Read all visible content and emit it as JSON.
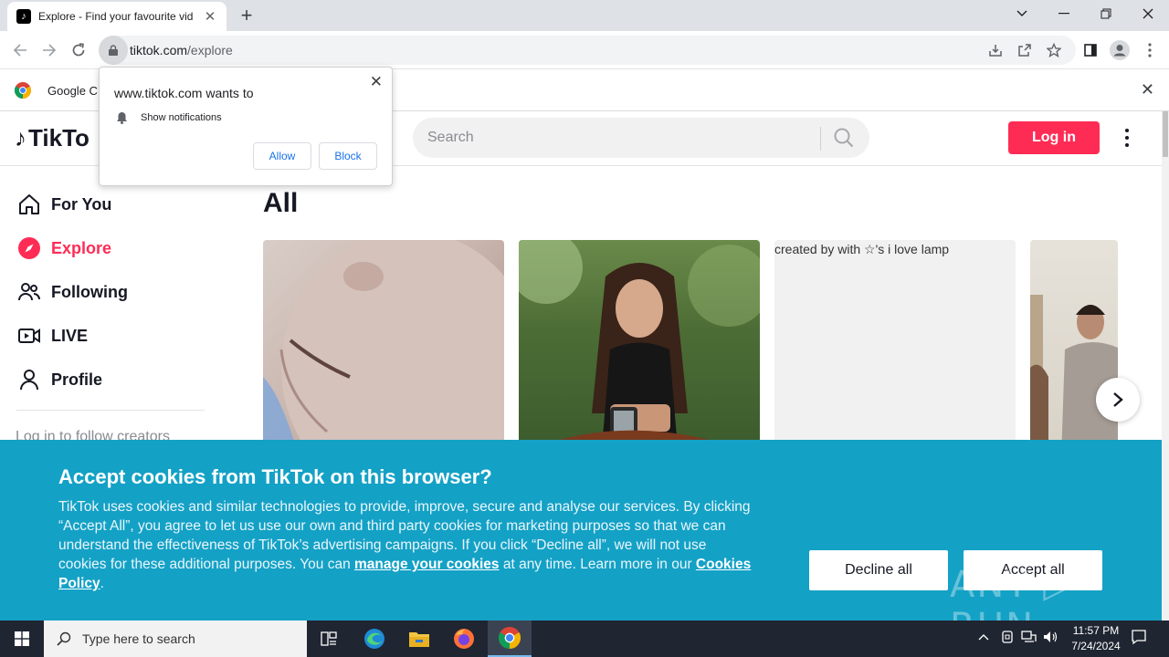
{
  "browser": {
    "tab_title": "Explore - Find your favourite vid",
    "url_host": "tiktok.com",
    "url_path": "/explore",
    "infobar_text": "Google C"
  },
  "permission_popup": {
    "title": "www.tiktok.com wants to",
    "item": "Show notifications",
    "allow_label": "Allow",
    "block_label": "Block"
  },
  "tiktok": {
    "logo": "TikTo",
    "search_placeholder": "Search",
    "login_label": "Log in",
    "nav": [
      {
        "label": "For You"
      },
      {
        "label": "Explore"
      },
      {
        "label": "Following"
      },
      {
        "label": "LIVE"
      },
      {
        "label": "Profile"
      }
    ],
    "nav_hint": "Log in to follow creators",
    "main_title": "All",
    "card3_alt": "created by    with ☆'s i love lamp"
  },
  "cookie_banner": {
    "title": "Accept cookies from TikTok on this browser?",
    "body_part1": "TikTok uses cookies and similar technologies to provide, improve, secure and analyse our services. By clicking “Accept All”, you agree to let us use our own and third party cookies for marketing purposes so that we can understand the effectiveness of TikTok’s advertising campaigns. If you click “Decline all”, we will not use cookies for these additional purposes. You can ",
    "manage_link": "manage your cookies",
    "body_part2": " at any time. Learn more in our ",
    "policy_link": "Cookies Policy",
    "body_part3": ".",
    "decline_label": "Decline all",
    "accept_label": "Accept all",
    "watermark": "ANY ▷ RUN"
  },
  "taskbar": {
    "search_placeholder": "Type here to search",
    "time": "11:57 PM",
    "date": "7/24/2024"
  },
  "colors": {
    "tiktok_red": "#fe2c55",
    "cookie_bg": "#14a1c6"
  }
}
